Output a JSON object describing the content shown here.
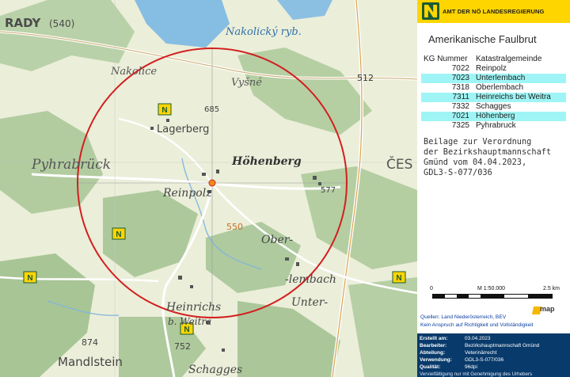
{
  "map": {
    "labels": {
      "rady": "RADY",
      "route540": "(540)",
      "nakolicky": "Nakolický ryb.",
      "nakolice": "Nakolice",
      "vysne": "Vyšné",
      "pyhrabruck": "Pyhrabrück",
      "lagerberg": "Lagerberg",
      "elev685": "685",
      "hohenberg": "Höhenberg",
      "ces": "ČES",
      "reinpolz": "Reinpolz",
      "elev577": "577",
      "elev550": "550",
      "ober": "Ober-",
      "lembach": "-lembach",
      "unter": "Unter-",
      "route512": "512",
      "heinrichs": "Heinrichs",
      "bweitra": "b. Weitra",
      "elev874": "874",
      "elev752": "752",
      "mandlstein": "Mandlstein",
      "schagges": "Schagges"
    },
    "colors": {
      "circle": "#d21f1f",
      "water": "#7fb6de",
      "forest": "#a9c79a",
      "open": "#ebeed9"
    }
  },
  "panel": {
    "agency": "AMT DER NÖ LANDESREGIERUNG",
    "title": "Amerikanische Faulbrut",
    "table": {
      "headers": [
        "KG Nummer",
        "Katastralgemeinde"
      ],
      "rows": [
        [
          "7022",
          "Reinpolz"
        ],
        [
          "7023",
          "Unterlembach"
        ],
        [
          "7318",
          "Oberlembach"
        ],
        [
          "7311",
          "Heinreichs bei Weitra"
        ],
        [
          "7332",
          "Schagges"
        ],
        [
          "7021",
          "Höhenberg"
        ],
        [
          "7325",
          "Pyhrabruck"
        ]
      ]
    },
    "beilage": [
      "Beilage zur Verordnung",
      "der Bezirkshauptmannschaft",
      "Gmünd vom 04.04.2023,",
      "GDL3-S-077/036"
    ],
    "scale": {
      "zero": "0",
      "ratio": "M 1:50.000",
      "max": "2.5 km"
    },
    "imap": "map",
    "quellen": [
      "Quellen: Land Niederösterreich, BEV",
      "Kein Anspruch auf Richtigkeit und Vollständigkeit"
    ],
    "info": [
      {
        "k": "Erstellt am:",
        "v": "03.04.2023"
      },
      {
        "k": "Bearbeiter:",
        "v": "Bezirkshauptmannschaft Gmünd"
      },
      {
        "k": "Abteilung:",
        "v": "Veterinärrecht"
      },
      {
        "k": "Verwendung:",
        "v": "GDL3-S-077/036"
      },
      {
        "k": "Qualität:",
        "v": "96dpi"
      }
    ],
    "footer": "Vervielfältigung nur mit Genehmigung des Urhebers"
  }
}
